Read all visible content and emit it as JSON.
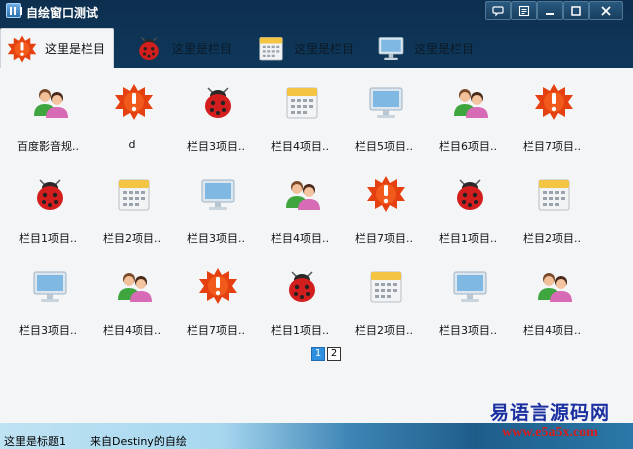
{
  "window": {
    "title": "自绘窗口测试"
  },
  "title_controls": [
    {
      "name": "chat-button",
      "icon": "speech-bubble-icon"
    },
    {
      "name": "menu-button",
      "icon": "list-icon"
    },
    {
      "name": "minimize-button",
      "icon": "minimize-icon"
    },
    {
      "name": "maximize-button",
      "icon": "maximize-icon"
    },
    {
      "name": "close-button",
      "icon": "close-icon"
    }
  ],
  "tabs": [
    {
      "label": "这里是栏目",
      "icon": "alert-badge-icon",
      "active": true
    },
    {
      "label": "这里是栏目",
      "icon": "ladybug-icon",
      "active": false
    },
    {
      "label": "这里是栏目",
      "icon": "calendar-icon",
      "active": false
    },
    {
      "label": "这里是栏目",
      "icon": "monitor-icon",
      "active": false
    }
  ],
  "grid": {
    "rows": [
      [
        {
          "label": "百度影音规..",
          "icon": "users-icon"
        },
        {
          "label": "d",
          "icon": "alert-badge-icon"
        },
        {
          "label": "栏目3项目..",
          "icon": "ladybug-icon"
        },
        {
          "label": "栏目4项目..",
          "icon": "calendar-icon"
        },
        {
          "label": "栏目5项目..",
          "icon": "monitor-icon"
        },
        {
          "label": "栏目6项目..",
          "icon": "users-icon"
        },
        {
          "label": "栏目7项目..",
          "icon": "alert-badge-icon"
        }
      ],
      [
        {
          "label": "栏目1项目..",
          "icon": "ladybug-icon"
        },
        {
          "label": "栏目2项目..",
          "icon": "calendar-icon"
        },
        {
          "label": "栏目3项目..",
          "icon": "monitor-icon"
        },
        {
          "label": "栏目4项目..",
          "icon": "users-icon"
        },
        {
          "label": "栏目7项目..",
          "icon": "alert-badge-icon"
        },
        {
          "label": "栏目1项目..",
          "icon": "ladybug-icon"
        },
        {
          "label": "栏目2项目..",
          "icon": "calendar-icon"
        }
      ],
      [
        {
          "label": "栏目3项目..",
          "icon": "monitor-icon"
        },
        {
          "label": "栏目4项目..",
          "icon": "users-icon"
        },
        {
          "label": "栏目7项目..",
          "icon": "alert-badge-icon"
        },
        {
          "label": "栏目1项目..",
          "icon": "ladybug-icon"
        },
        {
          "label": "栏目2项目..",
          "icon": "calendar-icon"
        },
        {
          "label": "栏目3项目..",
          "icon": "monitor-icon"
        },
        {
          "label": "栏目4项目..",
          "icon": "users-icon"
        }
      ]
    ]
  },
  "pager": {
    "pages": [
      "1",
      "2"
    ],
    "current": "1"
  },
  "status": {
    "left": "这里是标题1",
    "right": "来自Destiny的自绘"
  },
  "watermark": {
    "line1": "易语言源码网",
    "line2": "www.e5a5x.com"
  },
  "colors": {
    "accent": "#2f8fe0",
    "titlebar": "#0d2f4f",
    "content_bg": "#f4f5f7"
  }
}
